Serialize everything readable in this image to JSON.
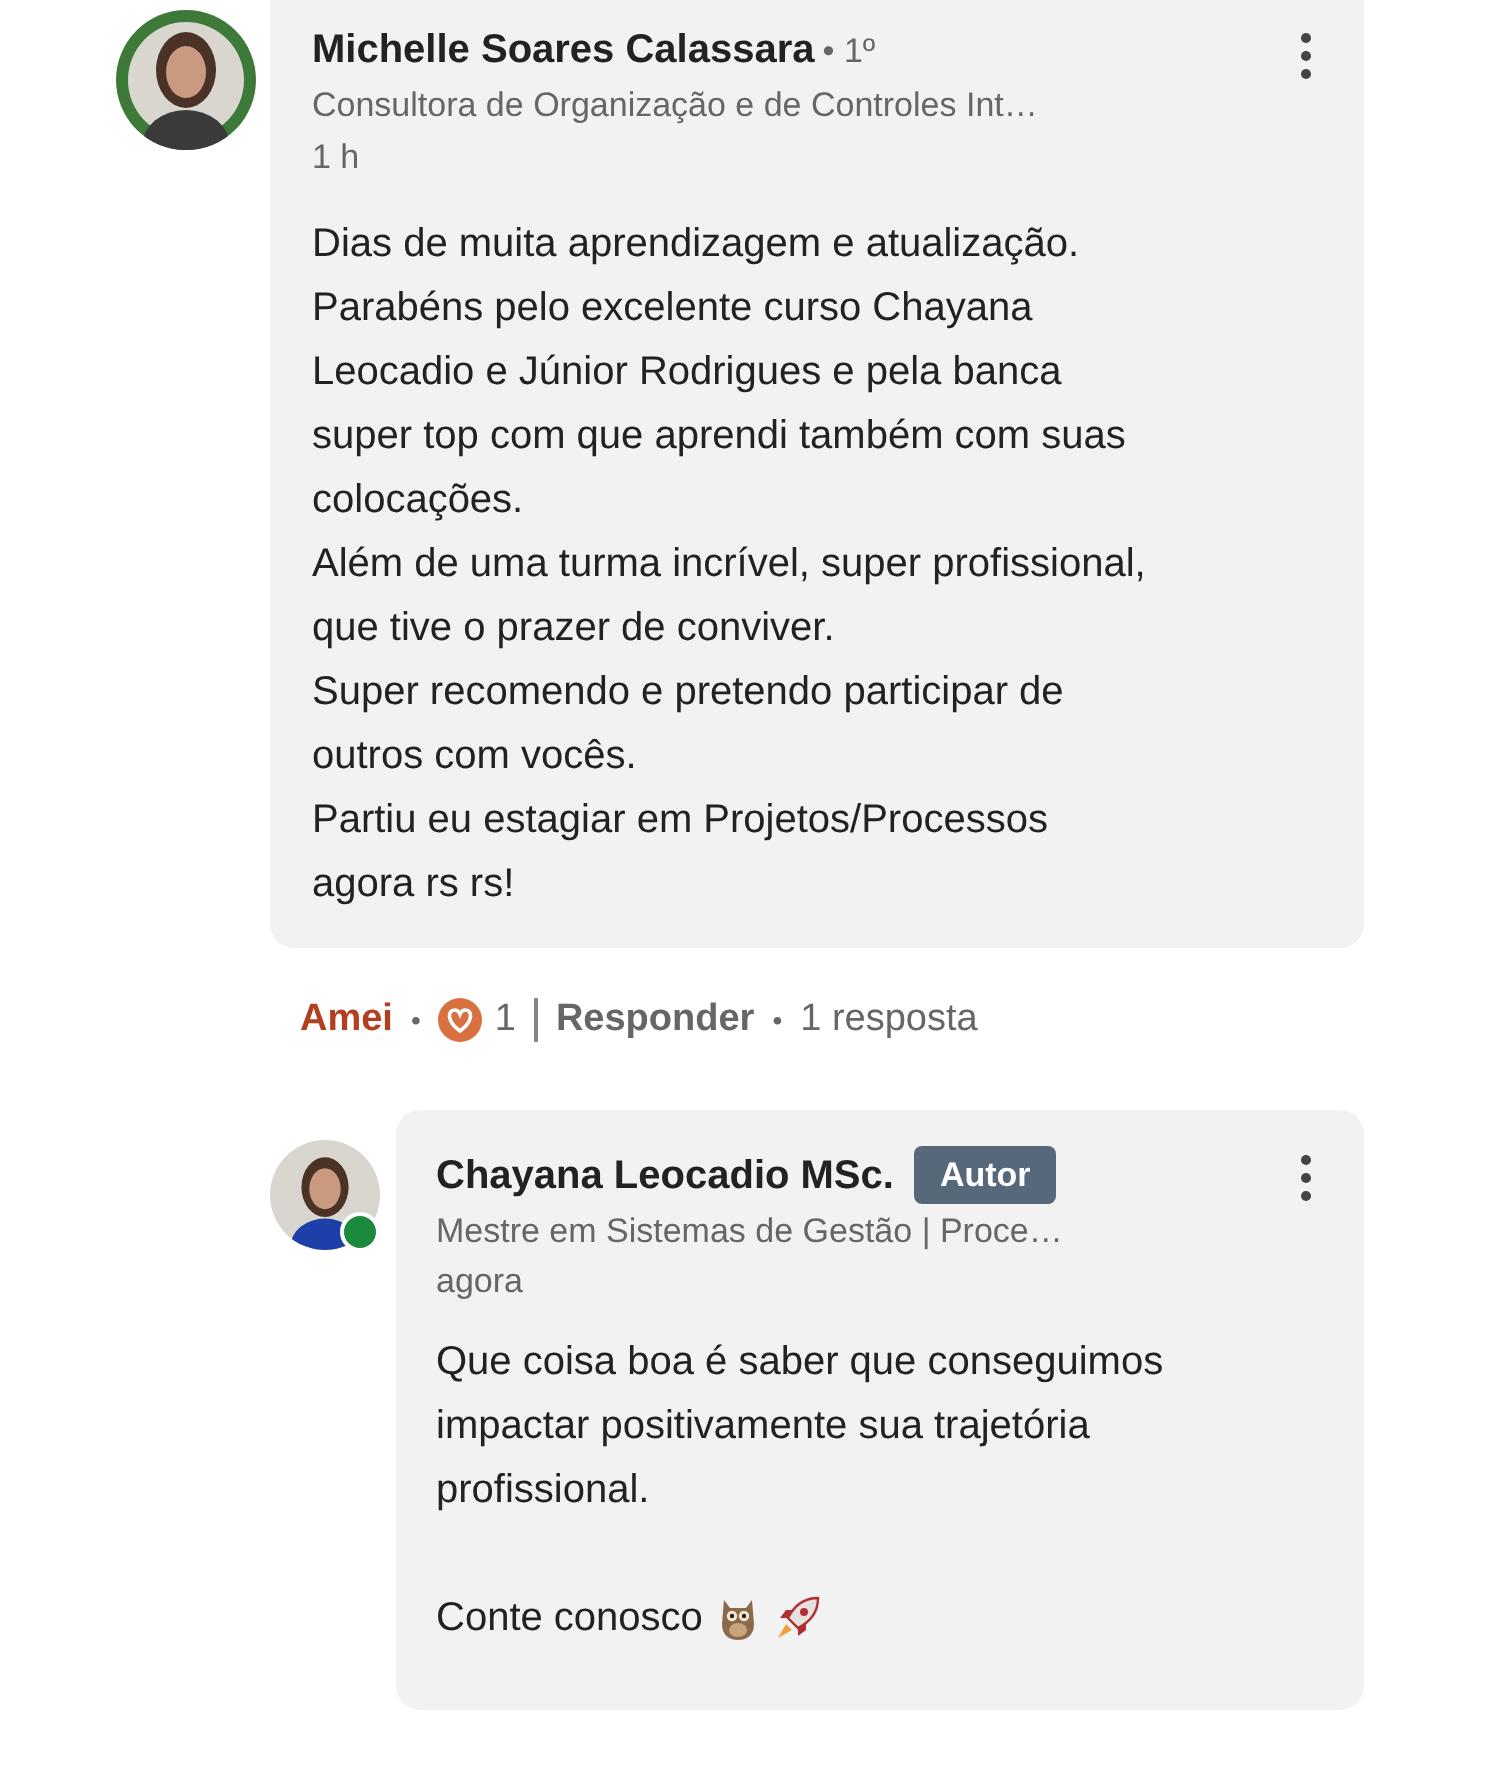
{
  "comment": {
    "author": "Michelle Soares Calassara",
    "degree": "• 1º",
    "headline": "Consultora de Organização e de Controles Int…",
    "time": "1 h",
    "paragraphs": [
      "Dias de muita aprendizagem e atualização.\nParabéns pelo excelente curso Chayana\nLeocadio e Júnior Rodrigues e pela banca\nsuper top com que aprendi também com suas\ncolocações.\nAlém de uma turma incrível, super profissional,\nque tive o prazer de conviver.\nSuper recomendo e pretendo participar de\noutros com vocês.\nPartiu eu estagiar em Projetos/Processos\nagora rs rs!"
    ]
  },
  "actions": {
    "reaction": "Amei",
    "reacted": true,
    "sep1": "•",
    "reaction_count": "1",
    "reply": "Responder",
    "sep2": "•",
    "replies": "1 resposta"
  },
  "reply": {
    "author": "Chayana Leocadio MSc.",
    "badge": "Autor",
    "online": true,
    "headline": "Mestre em Sistemas de Gestão | Proce…",
    "time": "agora",
    "paragraphs": [
      "Que coisa boa é saber que conseguimos\nimpactar positivamente sua trajetória\nprofissional.",
      "Conte conosco"
    ]
  }
}
